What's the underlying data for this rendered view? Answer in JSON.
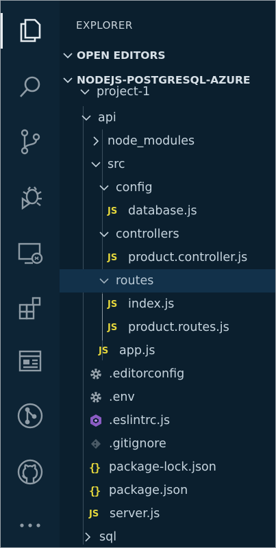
{
  "sidebar": {
    "title": "EXPLORER",
    "open_editors": "OPEN EDITORS",
    "project": "NODEJS-POSTGRESQL-AZURE"
  },
  "tree": [
    {
      "label": "project-1",
      "type": "folder-open"
    },
    {
      "label": "api",
      "type": "folder-open"
    },
    {
      "label": "node_modules",
      "type": "folder-closed"
    },
    {
      "label": "src",
      "type": "folder-open"
    },
    {
      "label": "config",
      "type": "folder-open"
    },
    {
      "label": "database.js",
      "type": "js"
    },
    {
      "label": "controllers",
      "type": "folder-open"
    },
    {
      "label": "product.controller.js",
      "type": "js"
    },
    {
      "label": "routes",
      "type": "folder-open",
      "selected": true
    },
    {
      "label": "index.js",
      "type": "js"
    },
    {
      "label": "product.routes.js",
      "type": "js"
    },
    {
      "label": "app.js",
      "type": "js"
    },
    {
      "label": ".editorconfig",
      "type": "gear"
    },
    {
      "label": ".env",
      "type": "gear"
    },
    {
      "label": ".eslintrc.js",
      "type": "eslint"
    },
    {
      "label": ".gitignore",
      "type": "git"
    },
    {
      "label": "package-lock.json",
      "type": "json"
    },
    {
      "label": "package.json",
      "type": "json"
    },
    {
      "label": "server.js",
      "type": "js"
    },
    {
      "label": "sql",
      "type": "folder-closed"
    }
  ],
  "icons": {
    "js": "JS",
    "json": "{}"
  },
  "activity_bar": [
    "files-icon",
    "search-icon",
    "source-control-icon",
    "debug-icon",
    "remote-explorer-icon",
    "extensions-icon",
    "preview-icon",
    "git-graph-icon",
    "github-icon",
    "more-icon"
  ],
  "colors": {
    "background": "#0b1f2e",
    "js": "#e4d63c",
    "eslint": "#8b5cc4",
    "selected_row": "#12314a"
  }
}
